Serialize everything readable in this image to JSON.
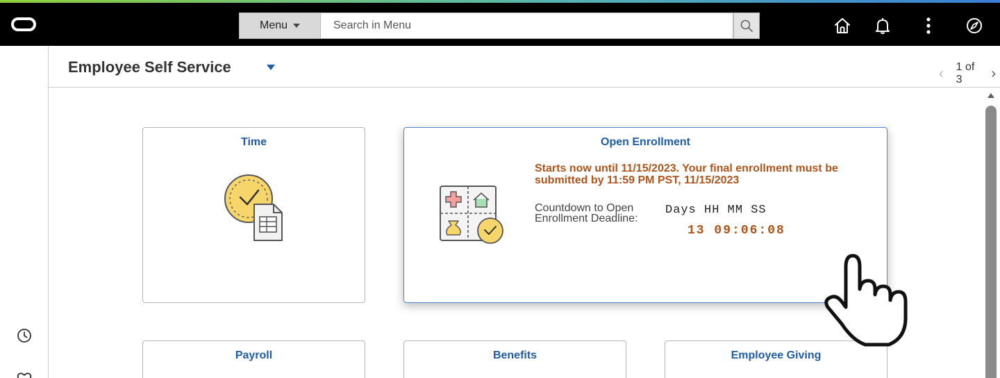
{
  "topbar": {
    "menu_label": "Menu",
    "search_placeholder": "Search in Menu"
  },
  "header": {
    "title": "Employee Self Service",
    "pager": {
      "current": 1,
      "total": 3,
      "text": "1 of 3"
    }
  },
  "tiles": {
    "time": {
      "title": "Time"
    },
    "open_enrollment": {
      "title": "Open Enrollment",
      "message": "Starts now until 11/15/2023. Your final enrollment must be submitted by 11:59 PM PST, 11/15/2023",
      "countdown_label": "Countdown to Open Enrollment Deadline:",
      "countdown_header": "Days HH MM SS",
      "countdown_days": "13",
      "countdown_time": "09:06:08"
    },
    "payroll": {
      "title": "Payroll"
    },
    "benefits": {
      "title": "Benefits"
    },
    "employee_giving": {
      "title": "Employee Giving"
    }
  },
  "icons": {
    "logo": "oracle-logo",
    "search": "search-icon",
    "home": "home-icon",
    "notifications": "bell-icon",
    "actions": "more-vertical-icon",
    "navbar": "compass-icon",
    "recent": "clock-icon",
    "favorites": "heart-icon"
  },
  "colors": {
    "topbar": "#000000",
    "tile_title": "#1f5ca8",
    "accent_orange": "#b0541a",
    "focus_border": "#4a86d6"
  }
}
